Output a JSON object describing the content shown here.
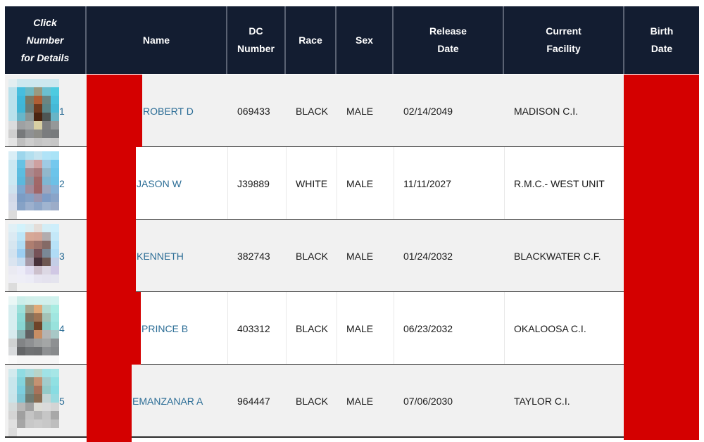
{
  "table": {
    "headers": {
      "details": [
        "Click",
        "Number",
        "for Details"
      ],
      "name": "Name",
      "dc_number": [
        "DC",
        "Number"
      ],
      "race": "Race",
      "sex": "Sex",
      "release_date": [
        "Release",
        "Date"
      ],
      "facility": [
        "Current",
        "Facility"
      ],
      "birth_date": [
        "Birth",
        "Date"
      ]
    },
    "rows": [
      {
        "number": "1",
        "name": "ROBERT D",
        "dc_number": "069433",
        "race": "BLACK",
        "sex": "MALE",
        "release_date": "02/14/2049",
        "facility": "MADISON C.I.",
        "birth_date": "",
        "photo": [
          [
            "#e3eef1",
            "#cde8ef",
            "#cde8ef",
            "#cde8ef",
            "#cde8ef",
            "#cde8ef"
          ],
          [
            "#b9e1ec",
            "#47bede",
            "#6fb8c1",
            "#9a9a80",
            "#6bc0d0",
            "#4dcbe0"
          ],
          [
            "#b9e1ec",
            "#3fb8da",
            "#7a7a66",
            "#b05e34",
            "#6a8582",
            "#48c0dc"
          ],
          [
            "#b9e1ec",
            "#41b6d6",
            "#6a7c78",
            "#6e3a1e",
            "#5b8588",
            "#46b8d6"
          ],
          [
            "#b9e1ec",
            "#68b6ca",
            "#8b9594",
            "#4a2410",
            "#4e5553",
            "#68b4c6"
          ],
          [
            "#dbdcdd",
            "#9ea1a3",
            "#a6a8a8",
            "#d8cfa3",
            "#7e7f80",
            "#959899"
          ],
          [
            "#cfcfcf",
            "#77797b",
            "#8f9193",
            "#8d8d88",
            "#7a7c7e",
            "#777a7c"
          ],
          [
            "#e4e4e4",
            "#bfbfbf",
            "#cdcdcd",
            "#c4c4c4",
            "#c9c9c9",
            "#c6c6c6"
          ]
        ]
      },
      {
        "number": "2",
        "name": "JASON W",
        "dc_number": "J39889",
        "race": "WHITE",
        "sex": "MALE",
        "release_date": "11/11/2027",
        "facility": "R.M.C.- WEST UNIT",
        "birth_date": "",
        "photo": [
          [
            "#daeef6",
            "#9dd6ec",
            "#b3dfef",
            "#c4e3ef",
            "#b0e3f7",
            "#a9e3f7"
          ],
          [
            "#cbe8f2",
            "#67c2e4",
            "#c8b8be",
            "#cea0a0",
            "#9fcbe4",
            "#74c8ee"
          ],
          [
            "#cbe8f2",
            "#5cbde0",
            "#aa8a90",
            "#a97a7c",
            "#92b8cc",
            "#6cc4ea"
          ],
          [
            "#cbe8f2",
            "#5cb8dc",
            "#8d929e",
            "#a26868",
            "#7fb6d2",
            "#6cc0e6"
          ],
          [
            "#cfe2ee",
            "#7ea8d0",
            "#a58a98",
            "#a06668",
            "#9ea6be",
            "#86b0d6"
          ],
          [
            "#d2d9e8",
            "#7c9cc4",
            "#86a0c4",
            "#9a96b0",
            "#7e9cc6",
            "#8aa4c8"
          ],
          [
            "#d6dcea",
            "#86a2c6",
            "#9cb0ce",
            "#8ea6c8",
            "#a0b4d0",
            "#9cacc8"
          ]
        ]
      },
      {
        "number": "3",
        "name": "KENNETH",
        "dc_number": "382743",
        "race": "BLACK",
        "sex": "MALE",
        "release_date": "01/24/2032",
        "facility": "BLACKWATER C.F.",
        "birth_date": "",
        "photo": [
          [
            "#e0f0f6",
            "#d2f2fb",
            "#dcecf0",
            "#e4ddd8",
            "#d2edf6",
            "#cdeefb"
          ],
          [
            "#dbeaf3",
            "#bde6f8",
            "#d7a896",
            "#d4a596",
            "#b2acae",
            "#c4e8f8"
          ],
          [
            "#d6e6f0",
            "#b0dcf4",
            "#ae7e70",
            "#9e746c",
            "#846a66",
            "#b8e2f8"
          ],
          [
            "#d2e2ef",
            "#9ccef2",
            "#8c868c",
            "#765258",
            "#7a8896",
            "#b0dcf6"
          ],
          [
            "#dae4f0",
            "#c6dcf0",
            "#a69aa8",
            "#48323a",
            "#6e5852",
            "#c4cee6"
          ],
          [
            "#eaeaf2",
            "#ececf8",
            "#e0dcf0",
            "#ccc0cc",
            "#dcd8e4",
            "#d0c8e4"
          ],
          [
            "#eeeef4",
            "#eeeef6",
            "#ececf6",
            "#e6e4f0",
            "#e4e2ee",
            "#e4e4ee"
          ]
        ]
      },
      {
        "number": "4",
        "name": "PRINCE B",
        "dc_number": "403312",
        "race": "BLACK",
        "sex": "MALE",
        "release_date": "06/23/2032",
        "facility": "OKALOOSA C.I.",
        "birth_date": "",
        "photo": [
          [
            "#eaf7f6",
            "#cceeea",
            "#d2efea",
            "#d2f0ec",
            "#d2f0ec",
            "#d0f2ee"
          ],
          [
            "#d6eef0",
            "#9ce0da",
            "#a8a48c",
            "#e0aa78",
            "#b2dcd2",
            "#a8ece2"
          ],
          [
            "#d6eef0",
            "#8cdad6",
            "#807260",
            "#9e7454",
            "#a4c2b6",
            "#a0e6e0"
          ],
          [
            "#d6eef0",
            "#88d6d2",
            "#668276",
            "#6e4428",
            "#88c8c2",
            "#98e2dc"
          ],
          [
            "#d8eaee",
            "#8ab4b4",
            "#606062",
            "#c88e64",
            "#b4b4b4",
            "#a8c8c6"
          ],
          [
            "#d0d2d2",
            "#828486",
            "#8e9092",
            "#9c9e9e",
            "#a4a6a6",
            "#8e9092"
          ],
          [
            "#d8dadc",
            "#646668",
            "#707274",
            "#6e7072",
            "#8e9092",
            "#888a8c"
          ],
          [
            "#fafafa",
            "#f6f6f6",
            "#f6f6f6",
            "#f6f6f6",
            "#f6f6f6",
            "#f6f6f6"
          ]
        ]
      },
      {
        "number": "5",
        "name": "EMANZANAR A",
        "dc_number": "964447",
        "race": "BLACK",
        "sex": "MALE",
        "release_date": "07/06/2030",
        "facility": "TAYLOR C.I.",
        "birth_date": "",
        "photo": [
          [
            "#d2eaee",
            "#90dce2",
            "#a8dadc",
            "#b8d4c8",
            "#a0e2e6",
            "#a6e6e6"
          ],
          [
            "#c8e6ec",
            "#84d4dc",
            "#888c78",
            "#c49272",
            "#a2cccc",
            "#90e0e2"
          ],
          [
            "#c8e6ec",
            "#7ccede",
            "#7a9088",
            "#a8725a",
            "#94cac8",
            "#88dce2"
          ],
          [
            "#c8e4ea",
            "#7cc4d2",
            "#6e7c74",
            "#8a6c52",
            "#c4d4d4",
            "#98dadf"
          ],
          [
            "#d4dada",
            "#b8b8b8",
            "#a0a0a0",
            "#dcdcd6",
            "#dadada",
            "#d4d4d4"
          ],
          [
            "#d4d4d4",
            "#a0a0a0",
            "#c4c4c4",
            "#b6b6b6",
            "#c6c6c6",
            "#a8a8a8"
          ],
          [
            "#e0e0e0",
            "#a6a6a6",
            "#c8c8c8",
            "#cccccc",
            "#c8c8c8",
            "#bebebe"
          ]
        ]
      }
    ]
  },
  "colors": {
    "header_bg": "#131d31",
    "link": "#2a6c95",
    "redaction": "#d40000",
    "row_shade": "#f1f1f1"
  }
}
